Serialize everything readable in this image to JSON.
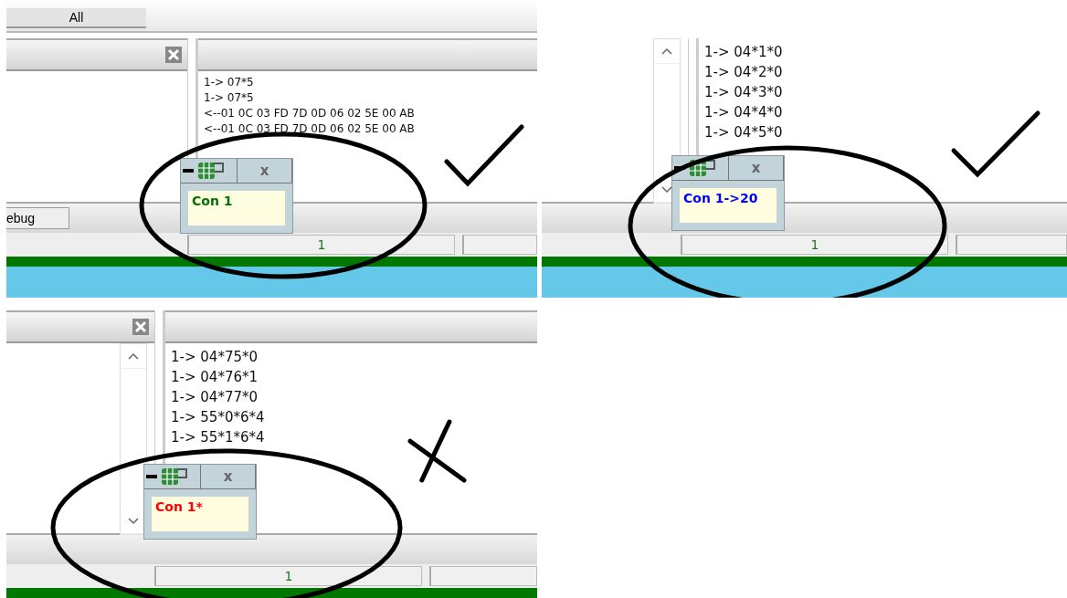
{
  "panels": [
    {
      "tabs": [
        {
          "label": "All",
          "selected": true
        }
      ],
      "close_button": true,
      "scrollbar": false,
      "log_lines": [
        "1-> 07*5",
        "1-> 07*5",
        "<--01 0C 03 FD 7D 0D 06 02 5E 00 AB",
        "<--01 0C 03 FD 7D 0D 06 02 5E 00 AB"
      ],
      "bottom_tab": "ebug",
      "status_value": "1",
      "blue_strip": true,
      "popup": {
        "label": "Con 1",
        "color": "#007000",
        "close_glyph": "x"
      },
      "annotation": {
        "kind": "check"
      }
    },
    {
      "close_button": false,
      "scrollbar": true,
      "log_lines": [
        "1-> 04*1*0",
        "1-> 04*2*0",
        "1-> 04*3*0",
        "1-> 04*4*0",
        "1-> 04*5*0"
      ],
      "status_value": "1",
      "blue_strip": true,
      "popup": {
        "label": "Con 1->20",
        "color": "#0000ff",
        "close_glyph": "x"
      },
      "annotation": {
        "kind": "check"
      }
    },
    {
      "close_button": true,
      "scrollbar": true,
      "log_lines": [
        "1-> 04*75*0",
        "1-> 04*76*1",
        "1-> 04*77*0",
        "1-> 55*0*6*4",
        "1-> 55*1*6*4"
      ],
      "status_value": "1",
      "blue_strip": false,
      "popup": {
        "label": "Con 1*",
        "color": "#ff0000",
        "close_glyph": "x"
      },
      "annotation": {
        "kind": "cross"
      }
    }
  ]
}
